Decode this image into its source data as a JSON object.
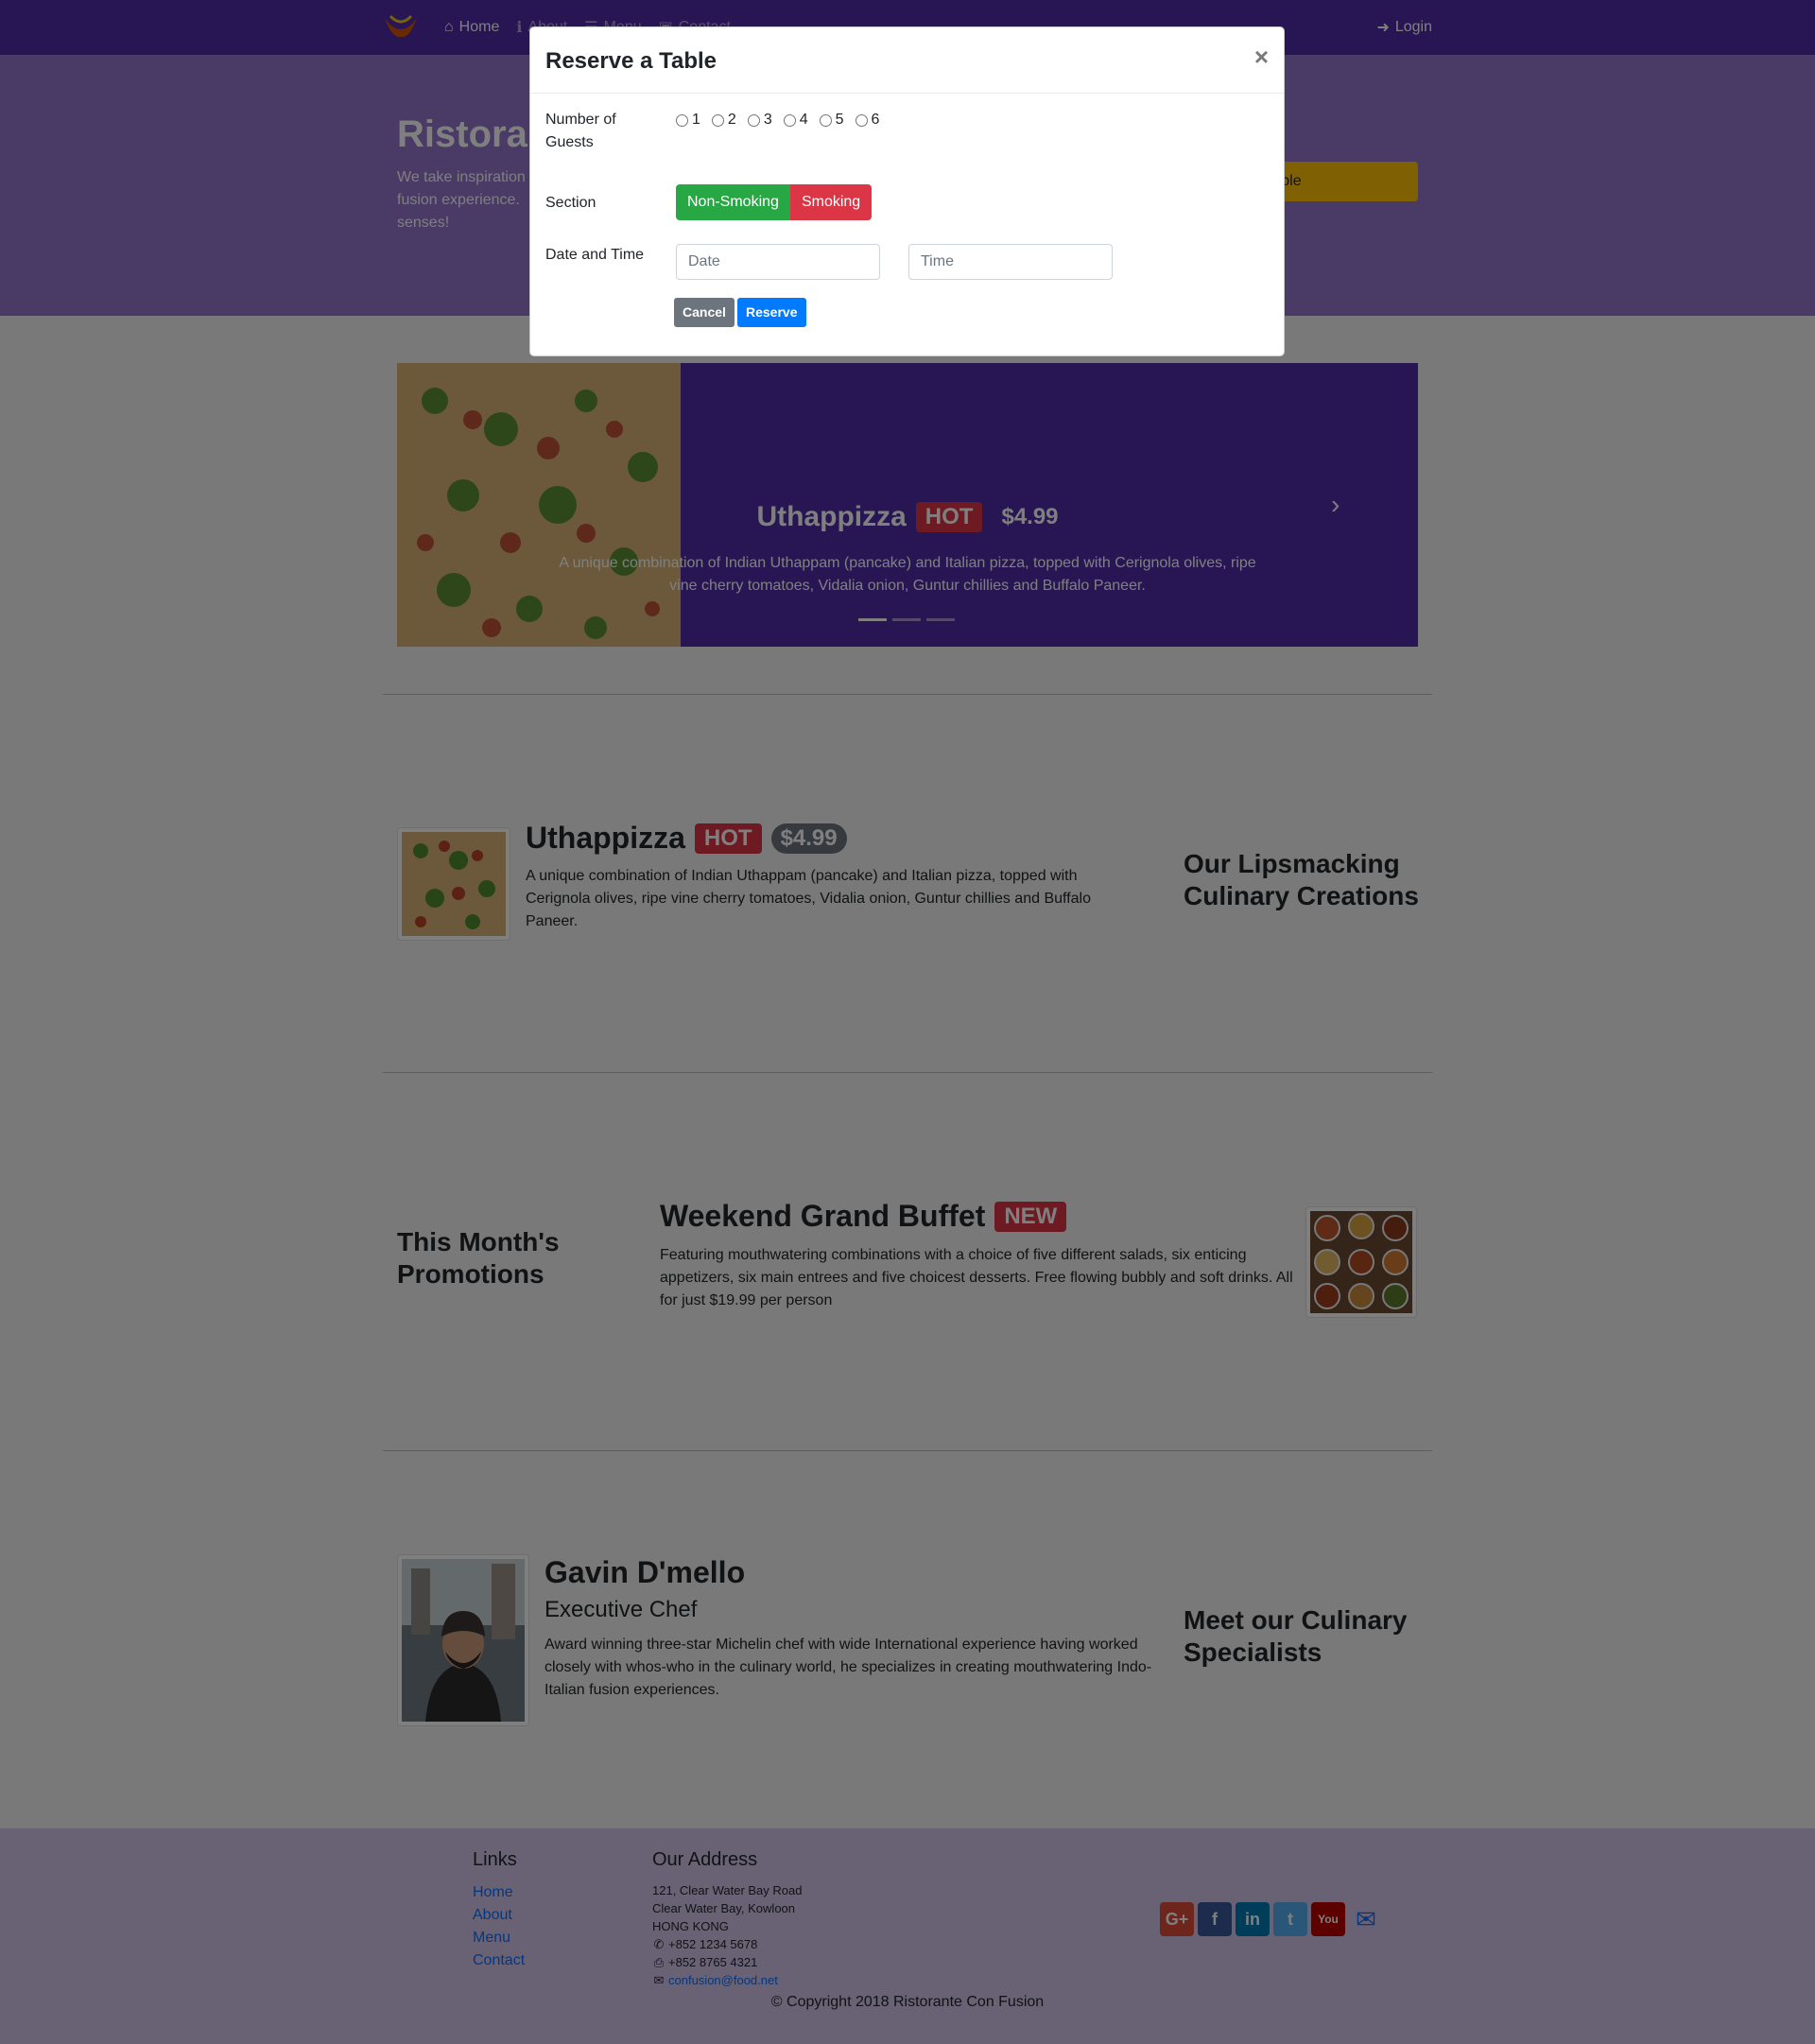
{
  "navbar": {
    "items": [
      {
        "label": "Home",
        "icon": "home-icon"
      },
      {
        "label": "About",
        "icon": "info-icon"
      },
      {
        "label": "Menu",
        "icon": "list-icon"
      },
      {
        "label": "Contact",
        "icon": "address-card-icon"
      }
    ],
    "login_label": "Login"
  },
  "jumbotron": {
    "title": "Ristoran",
    "text": "We take inspiration  fusion experience.  senses!",
    "text_lines": [
      "We take inspiration",
      "fusion experience.",
      "senses!"
    ],
    "reserve_label": "rve Table"
  },
  "carousel": {
    "title": "Uthappizza",
    "badge": "HOT",
    "price": "$4.99",
    "desc_line1": "A unique combination of Indian Uthappam (pancake) and Italian pizza, topped with Cerignola olives, ripe",
    "desc_line2": "vine cherry tomatoes, Vidalia onion, Guntur chillies and Buffalo Paneer.",
    "slides": 3,
    "active_slide": 1
  },
  "dish": {
    "title": "Uthappizza",
    "badge": "HOT",
    "price": "$4.99",
    "desc": "A unique combination of Indian Uthappam (pancake) and Italian pizza, topped with Cerignola olives, ripe vine cherry tomatoes, Vidalia onion, Guntur chillies and Buffalo Paneer.",
    "side_title": "Our Lipsmacking Culinary Creations"
  },
  "promotion": {
    "side_title": "This Month's Promotions",
    "title": "Weekend Grand Buffet",
    "badge": "NEW",
    "desc": "Featuring mouthwatering combinations with a choice of five different salads, six enticing appetizers, six main entrees and five choicest desserts. Free flowing bubbly and soft drinks. All for just $19.99 per person"
  },
  "leader": {
    "name": "Gavin D'mello",
    "role": "Executive Chef",
    "desc": "Award winning three-star Michelin chef with wide International experience having worked closely with whos-who in the culinary world, he specializes in creating mouthwatering Indo-Italian fusion experiences.",
    "side_title": "Meet our Culinary Specialists"
  },
  "footer": {
    "links_heading": "Links",
    "links": [
      "Home",
      "About",
      "Menu",
      "Contact"
    ],
    "address_heading": "Our Address",
    "address_lines": [
      "121, Clear Water Bay Road",
      "Clear Water Bay, Kowloon",
      "HONG KONG"
    ],
    "phone": "+852 1234 5678",
    "fax": "+852 8765 4321",
    "email": "confusion@food.net",
    "social": [
      {
        "label": "G+",
        "icon": "google-plus-icon",
        "color": "#dd4b39"
      },
      {
        "label": "f",
        "icon": "facebook-icon",
        "color": "#3b5998"
      },
      {
        "label": "in",
        "icon": "linkedin-icon",
        "color": "#007bb6"
      },
      {
        "label": "t",
        "icon": "twitter-icon",
        "color": "#55acee"
      },
      {
        "label": "You",
        "icon": "youtube-icon",
        "color": "#bb0000"
      }
    ],
    "copyright": "© Copyright 2018 Ristorante Con Fusion"
  },
  "modal": {
    "title": "Reserve a Table",
    "close_symbol": "×",
    "guests_label_1": "Number of",
    "guests_label_2": "Guests",
    "guests_options": [
      "1",
      "2",
      "3",
      "4",
      "5",
      "6"
    ],
    "section_label": "Section",
    "section_options": [
      "Non-Smoking",
      "Smoking"
    ],
    "datetime_label": "Date and Time",
    "date_placeholder": "Date",
    "time_placeholder": "Time",
    "cancel_label": "Cancel",
    "reserve_label": "Reserve"
  },
  "colors": {
    "primary": "#512da8",
    "jumbotron": "#9575cd",
    "footer": "#d1c4e9",
    "success": "#28a745",
    "danger": "#dc3545",
    "warning": "#ffc107",
    "link": "#007bff"
  }
}
